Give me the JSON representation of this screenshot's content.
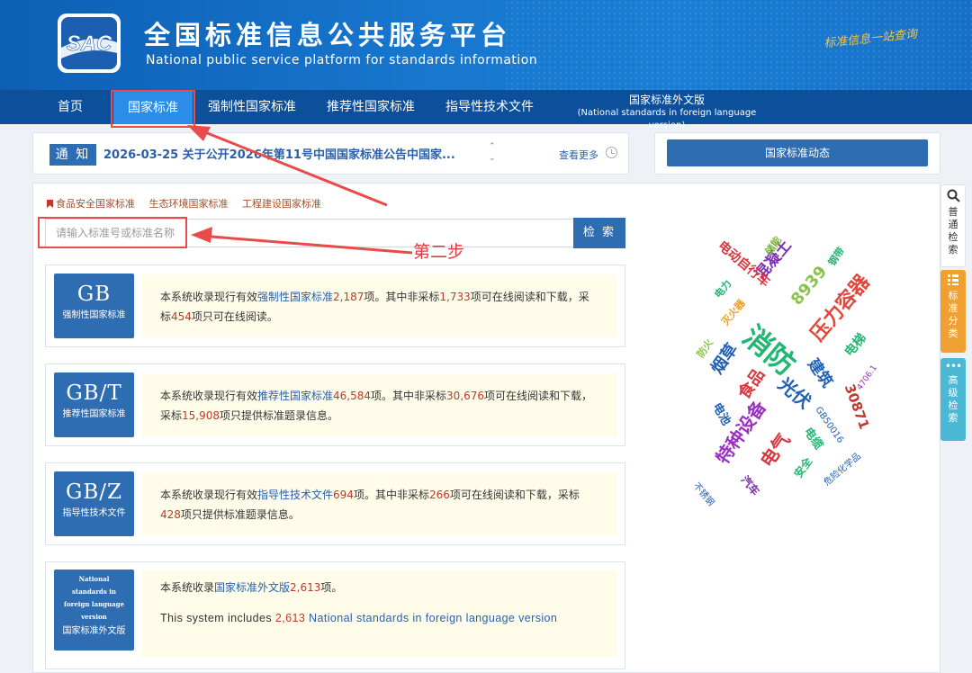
{
  "header": {
    "logo_text": "SAC",
    "title": "全国标准信息公共服务平台",
    "subtitle": "National public service platform  for standards information",
    "slogan": "标准信息一站查询"
  },
  "nav": {
    "items": [
      "首页",
      "国家标准",
      "强制性国家标准",
      "推荐性国家标准",
      "指导性技术文件"
    ],
    "foreign_line1": "国家标准外文版",
    "foreign_line2": "(National standards in foreign language version)"
  },
  "notice": {
    "tag": "通 知",
    "text": "2026-03-25  关于公开2026年第11号中国国家标准公告中国家...",
    "more": "查看更多"
  },
  "news_button": "国家标准动态",
  "categories": [
    "食品安全国家标准",
    "生态环境国家标准",
    "工程建设国家标准"
  ],
  "search": {
    "placeholder": "请输入标准号或标准名称",
    "button": "检 索"
  },
  "annotation": "第二步",
  "cards": [
    {
      "code": "GB",
      "name": "强制性国家标准",
      "t1": "本系统收录现行有效",
      "link": "强制性国家标准",
      "n1": "2,187",
      "t2": "项。其中非采标",
      "n2": "1,733",
      "t3": "项可在线阅读和下载，采标",
      "n3": "454",
      "t4": "项只可在线阅读。"
    },
    {
      "code": "GB/T",
      "name": "推荐性国家标准",
      "t1": "本系统收录现行有效",
      "link": "推荐性国家标准",
      "n1": "46,584",
      "t2": "项。其中非采标",
      "n2": "30,676",
      "t3": "项可在线阅读和下载，采标",
      "n3": "15,908",
      "t4": "项只提供标准题录信息。"
    },
    {
      "code": "GB/Z",
      "name": "指导性技术文件",
      "t1": "本系统收录现行有效",
      "link": "指导性技术文件",
      "n1": "694",
      "t2": "项。其中非采标",
      "n2": "266",
      "t3": "项可在线阅读和下载，采标",
      "n3": "428",
      "t4": "项只提供标准题录信息。"
    }
  ],
  "foreign_card": {
    "icon_lines": [
      "National",
      "standards in",
      "foreign language",
      "version"
    ],
    "name": "国家标准外文版",
    "t1": "本系统收录",
    "link": "国家标准外文版",
    "n1": "2,613",
    "t2": "项。",
    "en1": "This system includes",
    "en_n": "2,613",
    "en2": "National standards in foreign language version"
  },
  "word_cloud": [
    {
      "text": "消防",
      "color": "#22b573"
    },
    {
      "text": "压力容器",
      "color": "#e0483b"
    },
    {
      "text": "特种设备",
      "color": "#9b30c0"
    },
    {
      "text": "电气",
      "color": "#d9363e"
    },
    {
      "text": "光伏",
      "color": "#1f5fb4"
    },
    {
      "text": "建筑",
      "color": "#1f5fb4"
    },
    {
      "text": "食品",
      "color": "#d9363e"
    },
    {
      "text": "烟草",
      "color": "#1f5fb4"
    },
    {
      "text": "混凝土",
      "color": "#7a2fb0"
    },
    {
      "text": "电动自行车",
      "color": "#d9363e"
    },
    {
      "text": "8939",
      "color": "#8bc34a"
    },
    {
      "text": "30871",
      "color": "#c0392b"
    },
    {
      "text": "电梯",
      "color": "#22b573"
    },
    {
      "text": "电池",
      "color": "#1f5fb4"
    },
    {
      "text": "电缆",
      "color": "#22b573"
    },
    {
      "text": "汽车",
      "color": "#7a2fb0"
    },
    {
      "text": "安全",
      "color": "#22b573"
    },
    {
      "text": "GB50016",
      "color": "#1f5fb4"
    },
    {
      "text": "危险化学品",
      "color": "#1f5fb4"
    },
    {
      "text": "不锈钢",
      "color": "#1f5fb4"
    },
    {
      "text": "储能",
      "color": "#7cb342"
    },
    {
      "text": "钢带",
      "color": "#22b573"
    },
    {
      "text": "电力",
      "color": "#22b573"
    },
    {
      "text": "灭火器",
      "color": "#f39c12"
    },
    {
      "text": "防火",
      "color": "#8bc34a"
    },
    {
      "text": "4706.1",
      "color": "#9b30c0"
    }
  ],
  "side_tabs": [
    {
      "label": "普通检索",
      "color": "#ffffff",
      "text_color": "#333333"
    },
    {
      "label": "标准分类",
      "color": "#f0a030",
      "text_color": "#ffffff"
    },
    {
      "label": "高级检索",
      "color": "#4bb8d6",
      "text_color": "#ffffff"
    }
  ]
}
